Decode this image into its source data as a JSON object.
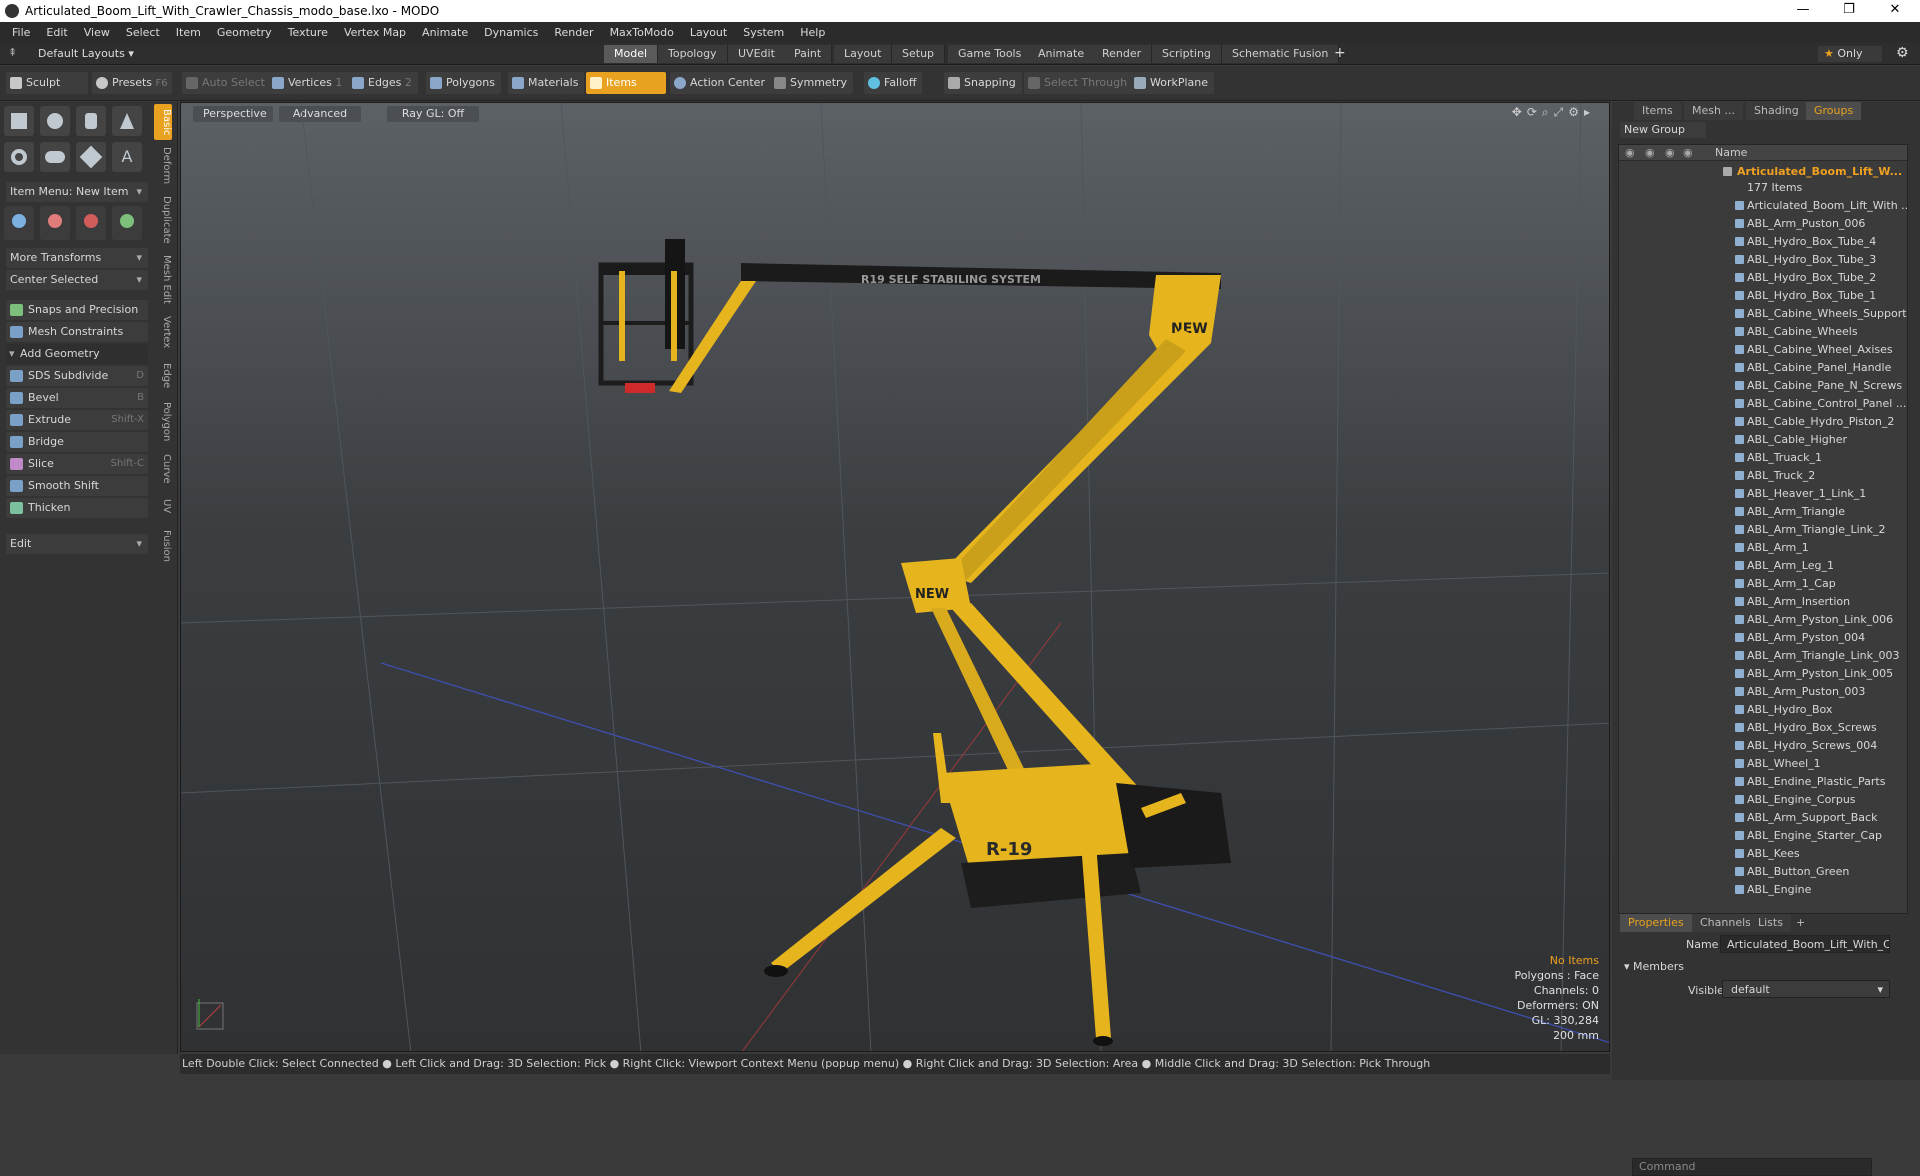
{
  "window": {
    "title": "Articulated_Boom_Lift_With_Crawler_Chassis_modo_base.lxo - MODO",
    "minimize": "—",
    "maximize": "❐",
    "close": "✕"
  },
  "menu": [
    "File",
    "Edit",
    "View",
    "Select",
    "Item",
    "Geometry",
    "Texture",
    "Vertex Map",
    "Animate",
    "Dynamics",
    "Render",
    "MaxToModo",
    "Layout",
    "System",
    "Help"
  ],
  "layouts": {
    "selector": "Default Layouts",
    "tabs": [
      "Model",
      "Topology",
      "UVEdit",
      "Paint",
      "Layout",
      "Setup",
      "Game Tools",
      "Animate",
      "Render",
      "Scripting",
      "Schematic Fusion"
    ],
    "active": "Model",
    "add": "+",
    "only": "Only"
  },
  "toolbar": {
    "sculpt": "Sculpt",
    "presets": "Presets",
    "presets_key": "F6",
    "auto_select": "Auto Select",
    "vertices": "Vertices",
    "vertices_n": "1",
    "edges": "Edges",
    "edges_n": "2",
    "polygons": "Polygons",
    "materials": "Materials",
    "items": "Items",
    "action_center": "Action Center",
    "symmetry": "Symmetry",
    "falloff": "Falloff",
    "snapping": "Snapping",
    "select_through": "Select Through",
    "workplane": "WorkPlane"
  },
  "leftpanel": {
    "item_menu": "Item Menu: New Item",
    "more_transforms": "More Transforms",
    "center_selected": "Center Selected",
    "snaps": "Snaps and Precision",
    "mesh_constraints": "Mesh Constraints",
    "add_geometry": "Add Geometry",
    "tools": [
      {
        "label": "SDS Subdivide",
        "key": "D"
      },
      {
        "label": "Bevel",
        "key": "B"
      },
      {
        "label": "Extrude",
        "key": "Shift-X"
      },
      {
        "label": "Bridge",
        "key": ""
      },
      {
        "label": "Slice",
        "key": "Shift-C"
      },
      {
        "label": "Smooth Shift",
        "key": ""
      },
      {
        "label": "Thicken",
        "key": ""
      }
    ],
    "edit": "Edit",
    "vtabs": [
      "Basic",
      "Deform",
      "Duplicate",
      "Mesh Edit",
      "Vertex",
      "Edge",
      "Polygon",
      "Curve",
      "UV",
      "Fusion"
    ]
  },
  "viewport": {
    "perspective": "Perspective",
    "advanced": "Advanced",
    "raygl": "Ray GL: Off",
    "info": {
      "items": "No Items",
      "polygons": "Polygons : Face",
      "channels": "Channels: 0",
      "deformers": "Deformers: ON",
      "gl": "GL: 330,284",
      "scale": "200 mm"
    },
    "label_boom": "R19  SELF STABILING SYSTEM",
    "label_new": "NEW",
    "label_r19": "R-19"
  },
  "status": "Left Double Click: Select Connected ● Left Click and Drag: 3D Selection: Pick ● Right Click: Viewport Context Menu (popup menu) ● Right Click and Drag: 3D Selection: Area ● Middle Click and Drag: 3D Selection: Pick Through",
  "rightpanel": {
    "tabs": [
      "Items",
      "Mesh ...",
      "Shading",
      "Groups"
    ],
    "active_tab": "Groups",
    "new_group": "New Group",
    "name_col": "Name",
    "group_name": "Articulated_Boom_Lift_W...",
    "group_count": "177 Items",
    "items": [
      "Articulated_Boom_Lift_With ...",
      "ABL_Arm_Puston_006",
      "ABL_Hydro_Box_Tube_4",
      "ABL_Hydro_Box_Tube_3",
      "ABL_Hydro_Box_Tube_2",
      "ABL_Hydro_Box_Tube_1",
      "ABL_Cabine_Wheels_Support",
      "ABL_Cabine_Wheels",
      "ABL_Cabine_Wheel_Axises",
      "ABL_Cabine_Panel_Handle",
      "ABL_Cabine_Pane_N_Screws",
      "ABL_Cabine_Control_Panel ...",
      "ABL_Cable_Hydro_Piston_2",
      "ABL_Cable_Higher",
      "ABL_Truack_1",
      "ABL_Truck_2",
      "ABL_Heaver_1_Link_1",
      "ABL_Arm_Triangle",
      "ABL_Arm_Triangle_Link_2",
      "ABL_Arm_1",
      "ABL_Arm_Leg_1",
      "ABL_Arm_1_Cap",
      "ABL_Arm_Insertion",
      "ABL_Arm_Pyston_Link_006",
      "ABL_Arm_Pyston_004",
      "ABL_Arm_Triangle_Link_003",
      "ABL_Arm_Pyston_Link_005",
      "ABL_Arm_Puston_003",
      "ABL_Hydro_Box",
      "ABL_Hydro_Box_Screws",
      "ABL_Hydro_Screws_004",
      "ABL_Wheel_1",
      "ABL_Endine_Plastic_Parts",
      "ABL_Engine_Corpus",
      "ABL_Arm_Support_Back",
      "ABL_Engine_Starter_Cap",
      "ABL_Kees",
      "ABL_Button_Green",
      "ABL_Engine"
    ],
    "props_tabs": [
      "Properties",
      "Channels",
      "Lists",
      "+"
    ],
    "name_label": "Name",
    "name_value": "Articulated_Boom_Lift_With_Crav",
    "members": "Members",
    "visible_label": "Visible",
    "visible_value": "default",
    "command_placeholder": "Command"
  },
  "colors": {
    "accent": "#e8a21f",
    "boom": "#e6b51e"
  }
}
